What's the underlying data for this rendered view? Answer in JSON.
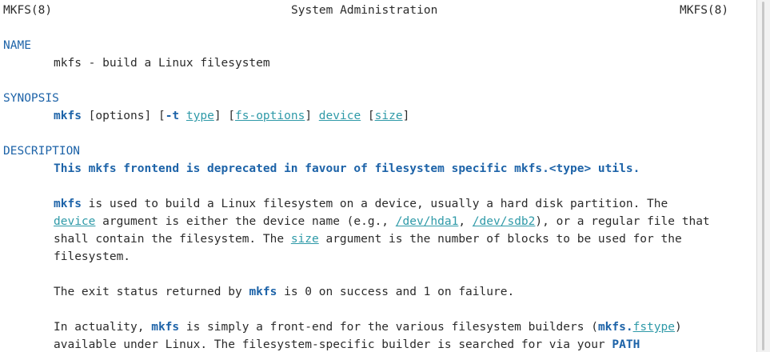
{
  "header": {
    "left": "MKFS(8)",
    "center": "System Administration",
    "right": "MKFS(8)"
  },
  "sections": {
    "name": {
      "heading": "NAME",
      "text": "mkfs - build a Linux filesystem"
    },
    "synopsis": {
      "heading": "SYNOPSIS",
      "cmd": "mkfs",
      "options": " [options] [",
      "t_flag": "-t",
      "space1": " ",
      "type": "type",
      "sep1": "] [",
      "fs_options": "fs-options",
      "sep2": "] ",
      "device": "device",
      "sep3": " [",
      "size": "size",
      "end": "]"
    },
    "description": {
      "heading": "DESCRIPTION",
      "deprecated": "This mkfs frontend is deprecated in favour of filesystem specific mkfs.<type> utils.",
      "p1_l1_cmd": "mkfs",
      "p1_l1_rest": " is used to build a Linux filesystem on a device, usually a hard disk partition. The",
      "p1_l2_device": "device",
      "p1_l2_a": " argument is either the device name (e.g., ",
      "p1_l2_hda1": "/dev/hda1",
      "p1_l2_b": ", ",
      "p1_l2_sdb2": "/dev/sdb2",
      "p1_l2_c": "), or a regular file that",
      "p1_l3_a": "shall contain the filesystem. The ",
      "p1_l3_size": "size",
      "p1_l3_b": " argument is the number of blocks to be used for the",
      "p1_l4": "filesystem.",
      "p2_a": "The exit status returned by ",
      "p2_cmd": "mkfs",
      "p2_b": " is 0 on success and 1 on failure.",
      "p3_l1_a": "In actuality, ",
      "p3_l1_cmd": "mkfs",
      "p3_l1_b": " is simply a front-end for the various filesystem builders (",
      "p3_l1_mkfs": "mkfs.",
      "p3_l1_fstype": "fstype",
      "p3_l1_c": ")",
      "p3_l2_a": "available under Linux. The filesystem-specific builder is searched for via your ",
      "p3_l2_path": "PATH"
    }
  }
}
